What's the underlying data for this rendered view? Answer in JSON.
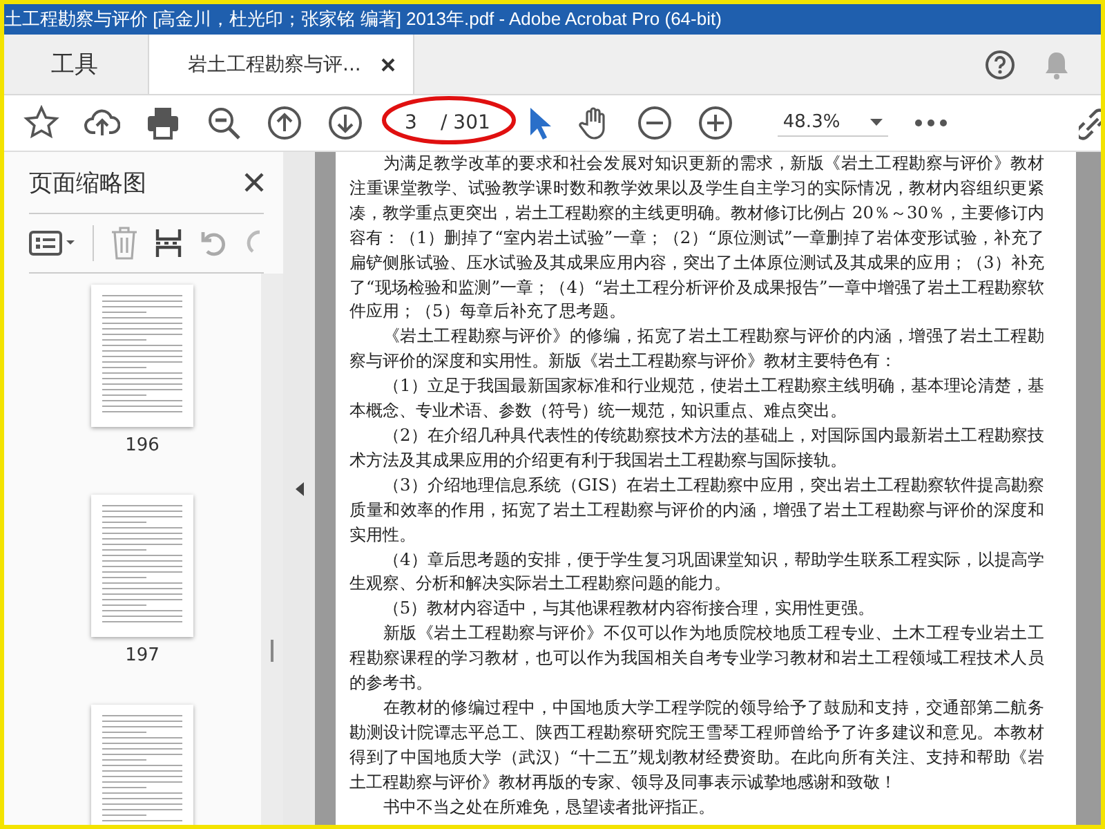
{
  "window": {
    "title": "土工程勘察与评价 [高金川，杜光印；张家铭 编著] 2013年.pdf - Adobe Acrobat Pro (64-bit)"
  },
  "tabs": [
    {
      "label": "工具",
      "kind": "tool",
      "selected": false
    },
    {
      "label": "岩土工程勘察与评...",
      "kind": "document",
      "selected": true
    }
  ],
  "toolbar": {
    "page_current": "3",
    "page_total": "/ 301",
    "zoom": "48.3%"
  },
  "sidebar": {
    "title": "页面缩略图",
    "thumbnails": [
      {
        "kind": "page",
        "label": "196"
      },
      {
        "kind": "page",
        "label": "197"
      },
      {
        "kind": "page"
      }
    ]
  },
  "document": {
    "paragraphs": [
      "为满足教学改革的要求和社会发展对知识更新的需求，新版《岩土工程勘察与评价》教材注重课堂教学、试验教学课时数和教学效果以及学生自主学习的实际情况，教材内容组织更紧凑，教学重点更突出，岩土工程勘察的主线更明确。教材修订比例占 20％～30％，主要修订内容有：（1）删掉了“室内岩土试验”一章；（2）“原位测试”一章删掉了岩体变形试验，补充了扁铲侧胀试验、压水试验及其成果应用内容，突出了土体原位测试及其成果的应用；（3）补充了“现场检验和监测”一章；（4）“岩土工程分析评价及成果报告”一章中增强了岩土工程勘察软件应用；（5）每章后补充了思考题。",
      "《岩土工程勘察与评价》的修编，拓宽了岩土工程勘察与评价的内涵，增强了岩土工程勘察与评价的深度和实用性。新版《岩土工程勘察与评价》教材主要特色有：",
      "（1）立足于我国最新国家标准和行业规范，使岩土工程勘察主线明确，基本理论清楚，基本概念、专业术语、参数（符号）统一规范，知识重点、难点突出。",
      "（2）在介绍几种具代表性的传统勘察技术方法的基础上，对国际国内最新岩土工程勘察技术方法及其成果应用的介绍更有利于我国岩土工程勘察与国际接轨。",
      "（3）介绍地理信息系统（GIS）在岩土工程勘察中应用，突出岩土工程勘察软件提高勘察质量和效率的作用，拓宽了岩土工程勘察与评价的内涵，增强了岩土工程勘察与评价的深度和实用性。",
      "（4）章后思考题的安排，便于学生复习巩固课堂知识，帮助学生联系工程实际，以提高学生观察、分析和解决实际岩土工程勘察问题的能力。",
      "（5）教材内容适中，与其他课程教材内容衔接合理，实用性更强。",
      "新版《岩土工程勘察与评价》不仅可以作为地质院校地质工程专业、土木工程专业岩土工程勘察课程的学习教材，也可以作为我国相关自考专业学习教材和岩土工程领域工程技术人员的参考书。",
      "在教材的修编过程中，中国地质大学工程学院的领导给予了鼓励和支持，交通部第二航务勘测设计院谭志平总工、陕西工程勘察研究院王雪琴工程师曾给予了许多建议和意见。本教材得到了中国地质大学（武汉）“十二五”规划教材经费资助。在此向所有关注、支持和帮助《岩土工程勘察与评价》教材再版的专家、领导及同事表示诚挚地感谢和致敬！",
      "书中不当之处在所难免，恳望读者批评指正。"
    ]
  }
}
